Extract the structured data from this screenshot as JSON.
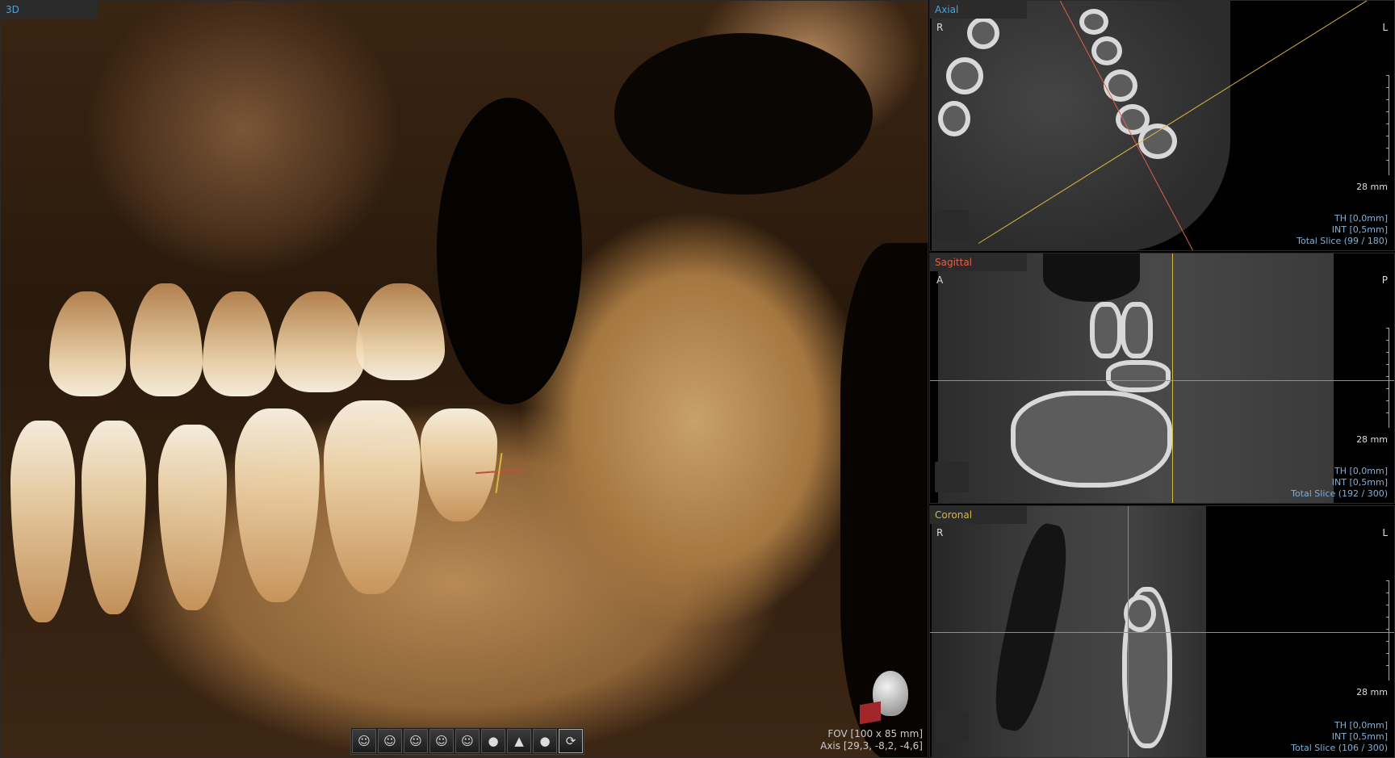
{
  "views": {
    "vr": {
      "tab": "3D",
      "fov": "FOV [100 x 85 mm]",
      "axis": "Axis [29,3, -8,2, -4,6]"
    },
    "axial": {
      "tab": "Axial",
      "left_marker": "R",
      "right_marker": "L",
      "scale": "28 mm",
      "th": "TH [0,0mm]",
      "int": "INT [0,5mm]",
      "slice": "Total Slice (99 / 180)"
    },
    "sagittal": {
      "tab": "Sagittal",
      "left_marker": "A",
      "right_marker": "P",
      "scale": "28 mm",
      "th": "TH [0,0mm]",
      "int": "INT [0,5mm]",
      "slice": "Total Slice (192 / 300)"
    },
    "coronal": {
      "tab": "Coronal",
      "left_marker": "R",
      "right_marker": "L",
      "scale": "28 mm",
      "th": "TH [0,0mm]",
      "int": "INT [0,5mm]",
      "slice": "Total Slice (106 / 300)"
    }
  },
  "toolbar": {
    "buttons": [
      {
        "icon": "head-right-view-icon",
        "glyph": "☺"
      },
      {
        "icon": "head-front-right-view-icon",
        "glyph": "☺"
      },
      {
        "icon": "head-front-view-icon",
        "glyph": "☺"
      },
      {
        "icon": "head-front-left-view-icon",
        "glyph": "☺"
      },
      {
        "icon": "head-left-view-icon",
        "glyph": "☺"
      },
      {
        "icon": "head-back-view-icon",
        "glyph": "●"
      },
      {
        "icon": "head-top-view-icon",
        "glyph": "▲"
      },
      {
        "icon": "head-bottom-view-icon",
        "glyph": "●"
      },
      {
        "icon": "reset-rotation-icon",
        "glyph": "⟳"
      }
    ]
  },
  "colors": {
    "tab_axial": "#4aa3e0",
    "tab_sagittal": "#e0604a",
    "tab_coronal": "#d9b840",
    "tab_3d": "#4aa3e0",
    "info_text": "#7fb0d8"
  }
}
